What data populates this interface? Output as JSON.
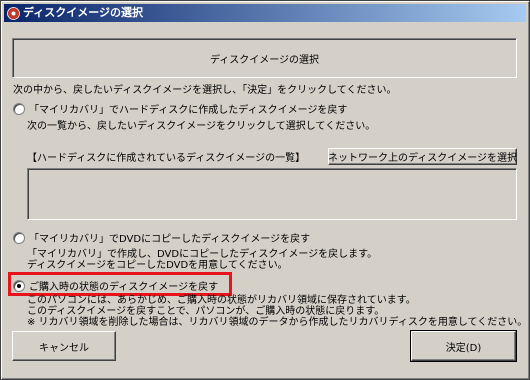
{
  "window": {
    "title": "ディスクイメージの選択",
    "header": "ディスクイメージの選択"
  },
  "instruction": "次の中から、戻したいディスクイメージを選択し、「決定」をクリックしてください。",
  "options": [
    {
      "label": "「マイリカバリ」でハードディスクに作成したディスクイメージを戻す",
      "selected": false,
      "description": "次の一覧から、戻したいディスクイメージをクリックして選択してください。"
    },
    {
      "label": "「マイリカバリ」でDVDにコピーしたディスクイメージを戻す",
      "selected": false,
      "description_lines": [
        "「マイリカバリ」で作成し、DVDにコピーしたディスクイメージを戻します。",
        "ディスクイメージをコピーしたDVDを用意してください。"
      ]
    },
    {
      "label": "ご購入時の状態のディスクイメージを戻す",
      "selected": true,
      "description_lines": [
        "このパソコンには、あらかじめ、ご購入時の状態がリカバリ領域に保存されています。",
        "このディスクイメージを戻すことで、パソコンが、ご購入時の状態に戻ります。",
        "※ リカバリ領域を削除した場合は、リカバリ領域のデータから作成したリカバリディスクを用意してください。"
      ]
    }
  ],
  "list_section": {
    "label": "【ハードディスクに作成されているディスクイメージの一覧】",
    "network_button": "ネットワーク上のディスクイメージを選択"
  },
  "buttons": {
    "cancel": "キャンセル",
    "ok": "決定(D)"
  },
  "colors": {
    "window_bg": "#d4d0c8",
    "title_start": "#0a246a",
    "title_end": "#a6caf0",
    "highlight": "#e8141c"
  }
}
